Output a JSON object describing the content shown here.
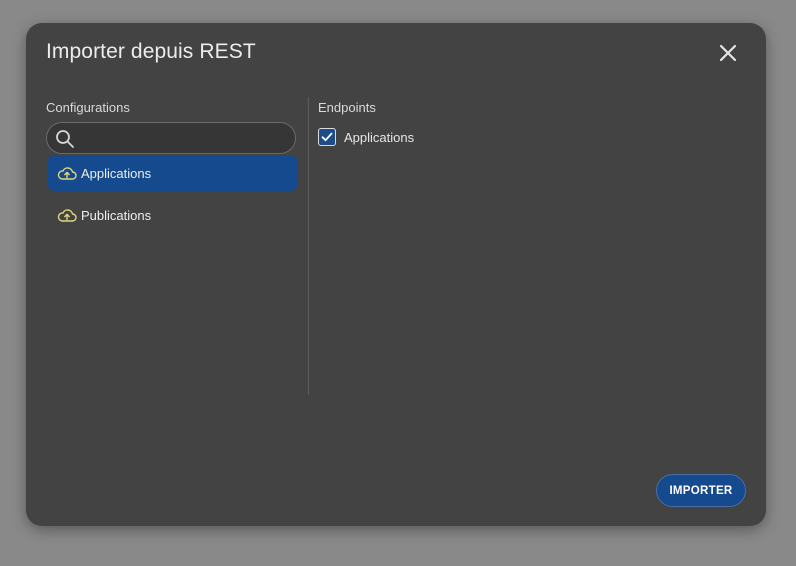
{
  "dialog": {
    "title": "Importer depuis REST",
    "close_icon": "close-icon"
  },
  "configurations": {
    "label": "Configurations",
    "search": {
      "value": "",
      "placeholder": "",
      "icon": "search-icon"
    },
    "items": [
      {
        "label": "Applications",
        "icon": "cloud-upload-icon",
        "selected": true
      },
      {
        "label": "Publications",
        "icon": "cloud-upload-icon",
        "selected": false
      }
    ]
  },
  "endpoints": {
    "label": "Endpoints",
    "items": [
      {
        "label": "Applications",
        "checked": true
      }
    ]
  },
  "footer": {
    "import_label": "IMPORTER"
  },
  "colors": {
    "overlay": "#898989",
    "dialog_bg": "#434343",
    "accent": "#154a8e",
    "icon_yellow": "#e3d77a"
  }
}
